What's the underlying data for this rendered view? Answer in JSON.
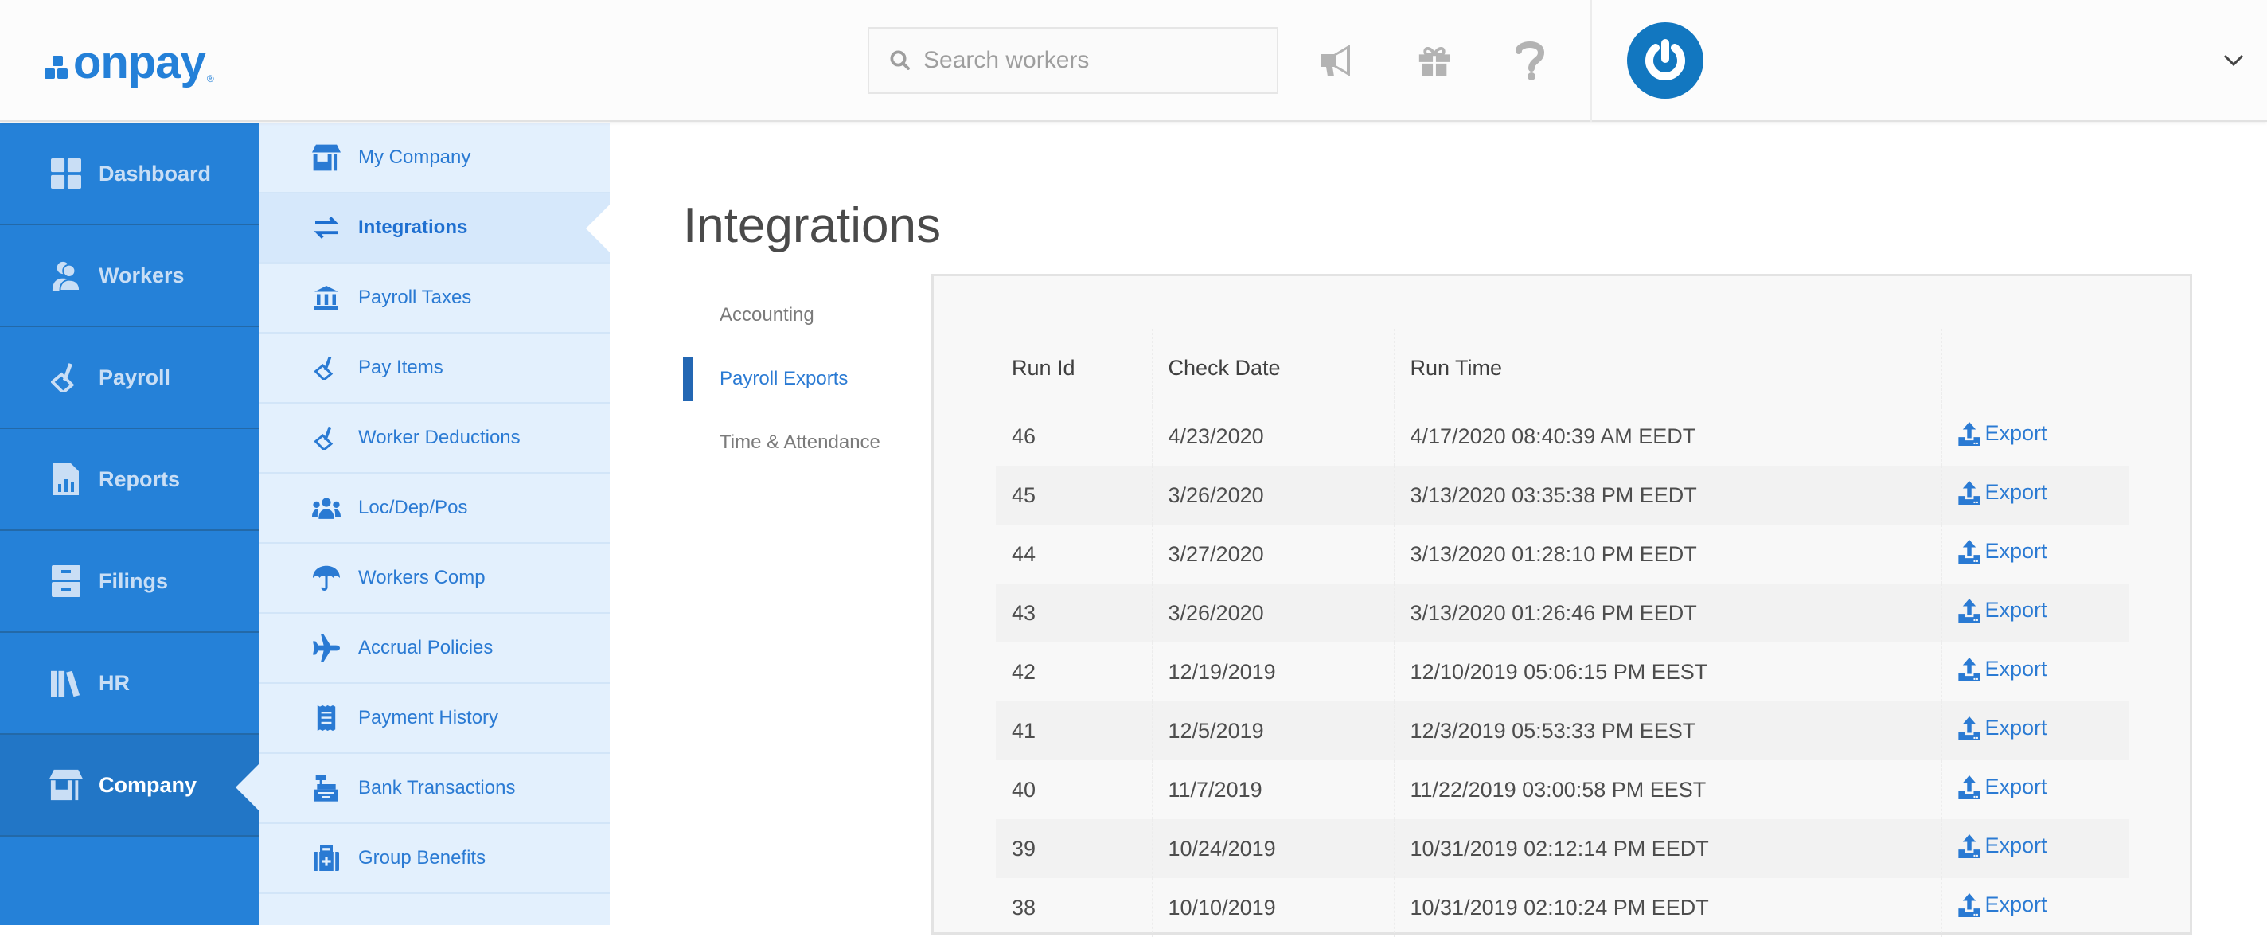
{
  "brand": {
    "name": "onpay",
    "registered": "®",
    "color": "#2480d8"
  },
  "header": {
    "search": {
      "placeholder": "Search workers",
      "value": ""
    },
    "icons": [
      "megaphone-icon",
      "gift-icon",
      "help-icon"
    ],
    "avatar": "power-logo",
    "menu_icon": "chevron-down-icon"
  },
  "primary_nav": {
    "items": [
      {
        "label": "Dashboard",
        "icon": "dashboard-icon",
        "active": false
      },
      {
        "label": "Workers",
        "icon": "workers-icon",
        "active": false
      },
      {
        "label": "Payroll",
        "icon": "payroll-icon",
        "active": false
      },
      {
        "label": "Reports",
        "icon": "reports-icon",
        "active": false
      },
      {
        "label": "Filings",
        "icon": "filings-icon",
        "active": false
      },
      {
        "label": "HR",
        "icon": "hr-icon",
        "active": false
      },
      {
        "label": "Company",
        "icon": "company-icon",
        "active": true
      }
    ]
  },
  "secondary_nav": {
    "items": [
      {
        "label": "My Company",
        "icon": "store-icon"
      },
      {
        "label": "Integrations",
        "icon": "exchange-icon",
        "active": true
      },
      {
        "label": "Payroll Taxes",
        "icon": "bank-icon"
      },
      {
        "label": "Pay Items",
        "icon": "sign-icon"
      },
      {
        "label": "Worker Deductions",
        "icon": "sign-icon"
      },
      {
        "label": "Loc/Dep/Pos",
        "icon": "users-icon"
      },
      {
        "label": "Workers Comp",
        "icon": "umbrella-icon"
      },
      {
        "label": "Accrual Policies",
        "icon": "plane-icon"
      },
      {
        "label": "Payment History",
        "icon": "receipt-icon"
      },
      {
        "label": "Bank Transactions",
        "icon": "cash-register-icon"
      },
      {
        "label": "Group Benefits",
        "icon": "medkit-icon"
      }
    ]
  },
  "main": {
    "title": "Integrations",
    "tabs": [
      {
        "label": "Accounting",
        "active": false
      },
      {
        "label": "Payroll Exports",
        "active": true
      },
      {
        "label": "Time & Attendance",
        "active": false
      }
    ],
    "table": {
      "columns": [
        "Run Id",
        "Check Date",
        "Run Time",
        ""
      ],
      "action_label": "Export",
      "rows": [
        {
          "run_id": "46",
          "check_date": "4/23/2020",
          "run_time": "4/17/2020 08:40:39 AM EEDT"
        },
        {
          "run_id": "45",
          "check_date": "3/26/2020",
          "run_time": "3/13/2020 03:35:38 PM EEDT"
        },
        {
          "run_id": "44",
          "check_date": "3/27/2020",
          "run_time": "3/13/2020 01:28:10 PM EEDT"
        },
        {
          "run_id": "43",
          "check_date": "3/26/2020",
          "run_time": "3/13/2020 01:26:46 PM EEDT"
        },
        {
          "run_id": "42",
          "check_date": "12/19/2019",
          "run_time": "12/10/2019 05:06:15 PM EEST"
        },
        {
          "run_id": "41",
          "check_date": "12/5/2019",
          "run_time": "12/3/2019 05:53:33 PM EEST"
        },
        {
          "run_id": "40",
          "check_date": "11/7/2019",
          "run_time": "11/22/2019 03:00:58 PM EEST"
        },
        {
          "run_id": "39",
          "check_date": "10/24/2019",
          "run_time": "10/31/2019 02:12:14 PM EEDT"
        },
        {
          "run_id": "38",
          "check_date": "10/10/2019",
          "run_time": "10/31/2019 02:10:24 PM EEDT"
        }
      ]
    }
  },
  "colors": {
    "primary_nav_bg": "#2581d8",
    "primary_nav_active": "#2276c6",
    "secondary_nav_bg": "#e3f0fd",
    "link_blue": "#2a7ad3",
    "avatar_blue": "#1277c0"
  }
}
